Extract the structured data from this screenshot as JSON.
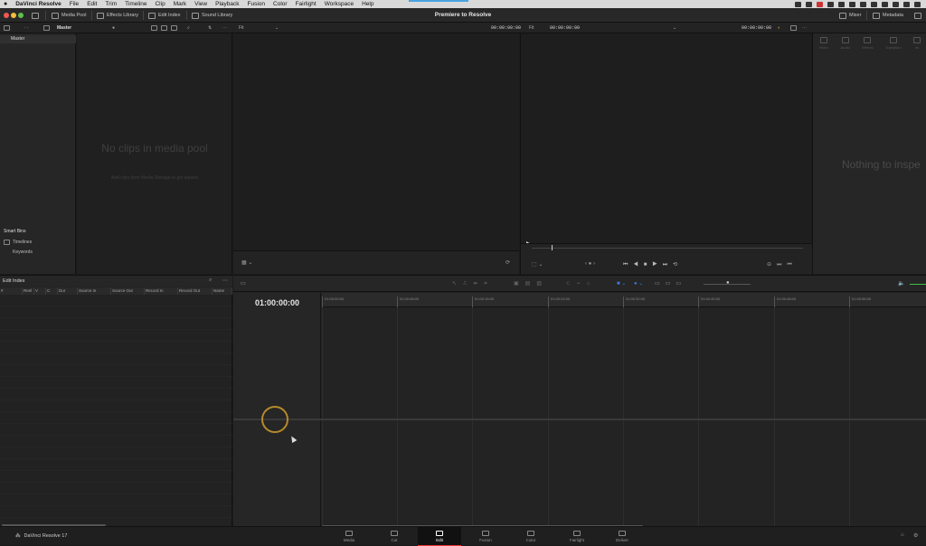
{
  "menubar": {
    "apple": "",
    "app": "DaVinci Resolve",
    "items": [
      "File",
      "Edit",
      "Trim",
      "Timeline",
      "Clip",
      "Mark",
      "View",
      "Playback",
      "Fusion",
      "Color",
      "Fairlight",
      "Workspace",
      "Help"
    ]
  },
  "toolbar": {
    "media_pool": "Media Pool",
    "effects_library": "Effects Library",
    "edit_index": "Edit Index",
    "sound_library": "Sound Library",
    "project_title": "Premiere to Resolve",
    "mixer": "Mixer",
    "metadata": "Metadata"
  },
  "subbar": {
    "bin_name": "Master",
    "source_zoom": "Fit",
    "source_tc": "00:00:00:00",
    "program_zoom": "Fit",
    "program_tc_left": "00:00:00:00",
    "program_tc_right": "00:00:00:00"
  },
  "bins": {
    "master": "Master",
    "smart_bins_title": "Smart Bins",
    "smart_items": [
      "Timelines",
      "Keywords"
    ]
  },
  "pool": {
    "empty_title": "No clips in media pool",
    "empty_hint": "Add clips from Media Storage to get started"
  },
  "inspector": {
    "tabs": [
      "Video",
      "Audio",
      "Effects",
      "Transition",
      "Im"
    ],
    "empty": "Nothing to inspe"
  },
  "edit_index": {
    "title": "Edit Index",
    "columns": [
      "#",
      "Reel",
      "V",
      "C",
      "Dur",
      "Source In",
      "Source Out",
      "Record In",
      "Record Out",
      "Name"
    ]
  },
  "timeline": {
    "timecode": "01:00:00:00",
    "ruler": [
      "01:00:00:00",
      "01:00:08:00",
      "01:00:16:00",
      "01:00:24:00",
      "01:00:32:00",
      "01:00:40:00",
      "01:00:48:00",
      "01:00:56:00"
    ]
  },
  "pagebar": {
    "brand": "DaVinci Resolve 17",
    "pages": [
      "Media",
      "Cut",
      "Edit",
      "Fusion",
      "Color",
      "Fairlight",
      "Deliver"
    ],
    "active": "Edit"
  },
  "colors": {
    "active_page_accent": "#e33333",
    "click_ring": "#b58a2a",
    "accent_blue": "#4aa3df"
  }
}
